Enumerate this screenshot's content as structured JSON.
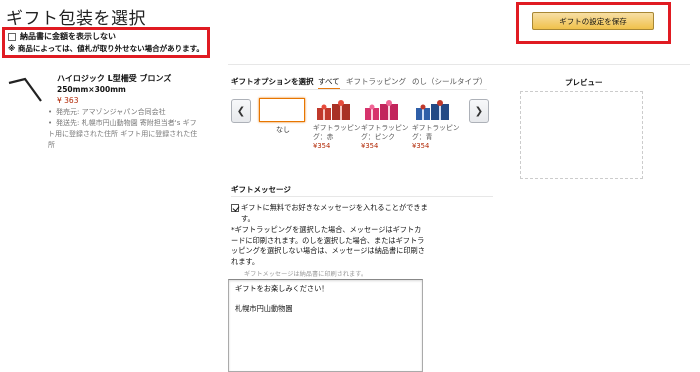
{
  "page": {
    "title": "ギフト包装を選択"
  },
  "options": {
    "hide_price_label": "納品書に金額を表示しない",
    "note": "※ 商品によっては、値札が取り外せない場合があります。"
  },
  "save_button": {
    "label": "ギフトの設定を保存"
  },
  "product": {
    "name": "ハイロジック L型柵受 ブロンズ",
    "size": "250mm×300mm",
    "price": "¥ 363",
    "seller": "発売元: アマゾンジャパン合同会社",
    "ship_to": "発送先: 札幌市円山動物園 寄附担当者's ギフト用に登録された住所 ギフト用に登録された住所"
  },
  "gift_options": {
    "label": "ギフトオプションを選択",
    "tabs": [
      {
        "label": "すべて",
        "active": true
      },
      {
        "label": "ギフトラッピング",
        "active": false
      },
      {
        "label": "のし（シールタイプ）",
        "active": false
      }
    ],
    "none_label": "なし",
    "items": [
      {
        "caption": "ギフトラッピング：赤",
        "price": "¥354",
        "color": "#c0392b"
      },
      {
        "caption": "ギフトラッピング：ピンク",
        "price": "¥354",
        "color": "#d6336c"
      },
      {
        "caption": "ギフトラッピング：青",
        "price": "¥354",
        "color": "#2e5fa8"
      }
    ],
    "prev_icon": "chevron-left-icon",
    "next_icon": "chevron-right-icon"
  },
  "message": {
    "heading": "ギフトメッセージ",
    "checkbox_label": "ギフトに無料でお好きなメッセージを入れることができます。",
    "info": "*ギフトラッピングを選択した場合、メッセージはギフトカードに印刷されます。のしを選択した場合、またはギフトラッピングを選択しない場合は、メッセージは納品書に印刷されます。",
    "small_note": "ギフトメッセージは納品書に印刷されます。",
    "text": "ギフトをお楽しみください！\n\n札幌市円山動物園"
  },
  "preview": {
    "title": "プレビュー"
  }
}
